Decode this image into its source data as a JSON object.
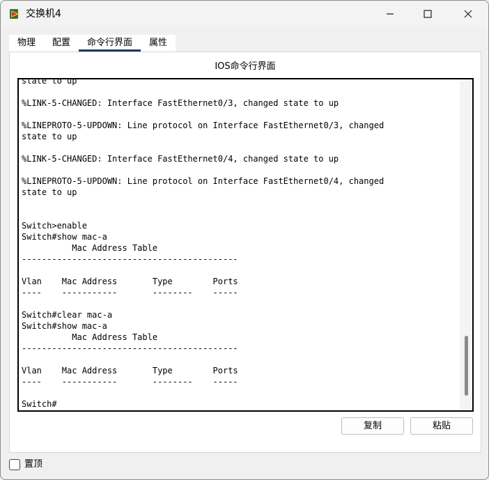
{
  "window": {
    "title": "交换机4"
  },
  "tabs": [
    {
      "label": "物理"
    },
    {
      "label": "配置"
    },
    {
      "label": "命令行界面"
    },
    {
      "label": "属性"
    }
  ],
  "cli": {
    "panel_title": "IOS命令行界面",
    "lines": [
      "state to up",
      "",
      "%LINK-5-CHANGED: Interface FastEthernet0/3, changed state to up",
      "",
      "%LINEPROTO-5-UPDOWN: Line protocol on Interface FastEthernet0/3, changed",
      "state to up",
      "",
      "%LINK-5-CHANGED: Interface FastEthernet0/4, changed state to up",
      "",
      "%LINEPROTO-5-UPDOWN: Line protocol on Interface FastEthernet0/4, changed",
      "state to up",
      "",
      "",
      "Switch>enable",
      "Switch#show mac-a",
      "          Mac Address Table",
      "-------------------------------------------",
      "",
      "Vlan    Mac Address       Type        Ports",
      "----    -----------       --------    -----",
      "",
      "Switch#clear mac-a",
      "Switch#show mac-a",
      "          Mac Address Table",
      "-------------------------------------------",
      "",
      "Vlan    Mac Address       Type        Ports",
      "----    -----------       --------    -----",
      "",
      "Switch#"
    ],
    "copy_label": "复制",
    "paste_label": "粘贴"
  },
  "footer": {
    "pin_label": "置顶"
  },
  "icons": {
    "app": "packet-tracer-switch-icon",
    "minimize": "minimize-icon",
    "maximize": "maximize-icon",
    "close": "close-icon"
  },
  "colors": {
    "tab_active_underline": "#1d3a5f",
    "terminal_border": "#000000",
    "window_bg": "#f0f0f0"
  }
}
